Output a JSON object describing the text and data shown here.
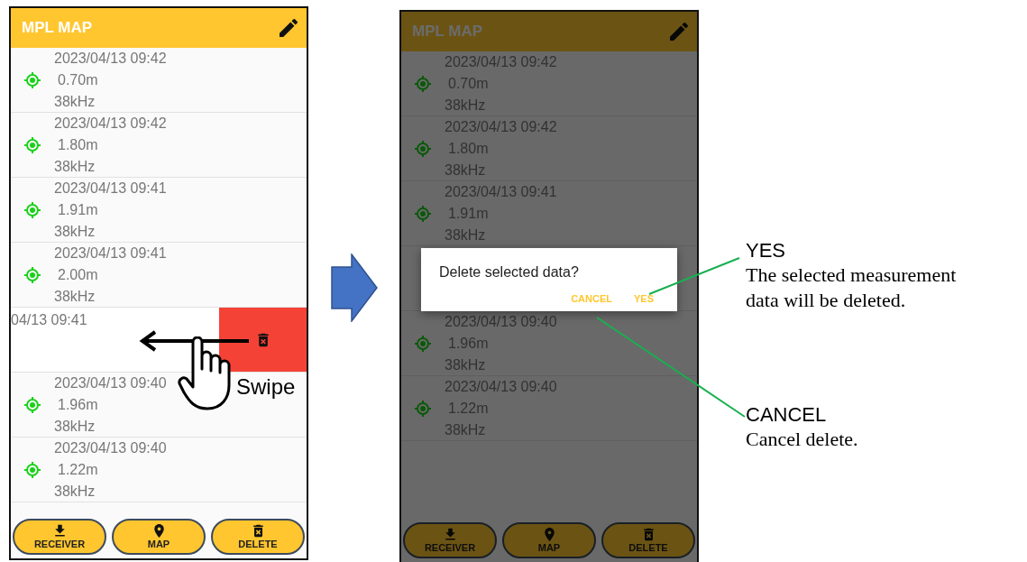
{
  "screens": [
    {
      "title": "MPL MAP",
      "dimmed": false,
      "rows": [
        {
          "kind": "record",
          "date": "2023/04/13 09:42",
          "depth": "0.70m",
          "frequency": "38kHz"
        },
        {
          "kind": "record",
          "date": "2023/04/13 09:42",
          "depth": "1.80m",
          "frequency": "38kHz"
        },
        {
          "kind": "record",
          "date": "2023/04/13 09:41",
          "depth": "1.91m",
          "frequency": "38kHz"
        },
        {
          "kind": "record",
          "date": "2023/04/13 09:41",
          "depth": "2.00m",
          "frequency": "38kHz"
        },
        {
          "kind": "swiped",
          "date": "04/13 09:41"
        },
        {
          "kind": "record",
          "date": "2023/04/13 09:40",
          "depth": "1.96m",
          "frequency": "38kHz"
        },
        {
          "kind": "record",
          "date": "2023/04/13 09:40",
          "depth": "1.22m",
          "frequency": "38kHz"
        }
      ],
      "gesture": {
        "label": "Swipe"
      },
      "buttons": [
        {
          "kind": "download",
          "label": "RECEIVER"
        },
        {
          "kind": "pin",
          "label": "MAP"
        },
        {
          "kind": "trash",
          "label": "DELETE"
        }
      ]
    },
    {
      "title": "MPL MAP",
      "dimmed": true,
      "rows": [
        {
          "kind": "record",
          "date": "2023/04/13 09:42",
          "depth": "0.70m",
          "frequency": "38kHz"
        },
        {
          "kind": "record",
          "date": "2023/04/13 09:42",
          "depth": "1.80m",
          "frequency": "38kHz"
        },
        {
          "kind": "record",
          "date": "2023/04/13 09:41",
          "depth": "1.91m",
          "frequency": "38kHz"
        },
        {
          "kind": "covered"
        },
        {
          "kind": "record",
          "date": "2023/04/13 09:40",
          "depth": "1.96m",
          "frequency": "38kHz"
        },
        {
          "kind": "record",
          "date": "2023/04/13 09:40",
          "depth": "1.22m",
          "frequency": "38kHz"
        }
      ],
      "dialog": {
        "message": "Delete selected data?",
        "actions": [
          {
            "label": "CANCEL"
          },
          {
            "label": "YES"
          }
        ]
      },
      "buttons": [
        {
          "kind": "download",
          "label": "RECEIVER"
        },
        {
          "kind": "pin",
          "label": "MAP"
        },
        {
          "kind": "trash",
          "label": "DELETE"
        }
      ]
    }
  ],
  "annotations": [
    {
      "title": "YES",
      "description": "The selected measurement data will be deleted."
    },
    {
      "title": "CANCEL",
      "description": "Cancel delete."
    }
  ]
}
